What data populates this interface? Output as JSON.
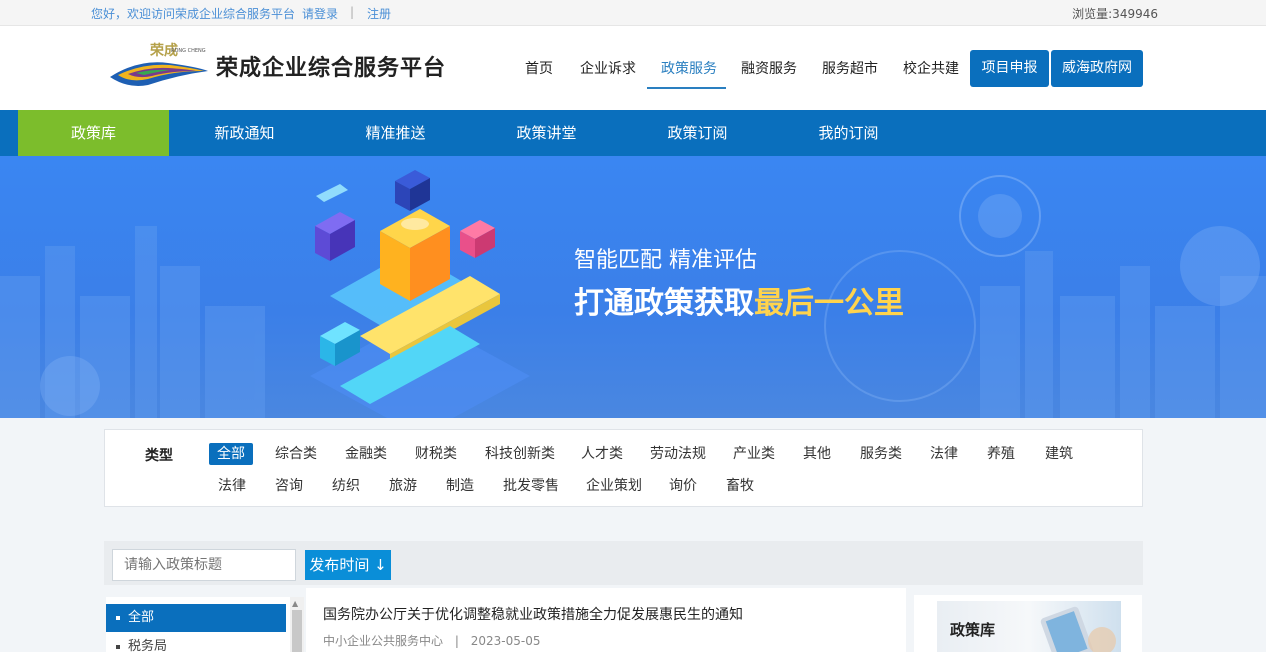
{
  "topbar": {
    "greeting": "您好，欢迎访问荣成企业综合服务平台",
    "login": "请登录",
    "separator": "|",
    "register": "注册",
    "views": "浏览量:349946"
  },
  "header": {
    "logo_text": "RONG CHENG",
    "site_title": "荣成企业综合服务平台",
    "nav": [
      {
        "label": "首页"
      },
      {
        "label": "企业诉求"
      },
      {
        "label": "政策服务"
      },
      {
        "label": "融资服务"
      },
      {
        "label": "服务超市"
      },
      {
        "label": "校企共建"
      }
    ],
    "active_nav": "政策服务",
    "buttons": [
      {
        "label": "项目申报"
      },
      {
        "label": "威海政府网"
      }
    ]
  },
  "subnav": {
    "items": [
      {
        "label": "政策库"
      },
      {
        "label": "新政通知"
      },
      {
        "label": "精准推送"
      },
      {
        "label": "政策讲堂"
      },
      {
        "label": "政策订阅"
      },
      {
        "label": "我的订阅"
      }
    ],
    "active": "政策库"
  },
  "banner": {
    "slogan_line1": "智能匹配 精准评估",
    "slogan_line2_a": "打通政策获取",
    "slogan_line2_b": "最后一公里"
  },
  "filter": {
    "label": "类型",
    "row1": [
      "全部",
      "综合类",
      "金融类",
      "财税类",
      "科技创新类",
      "人才类",
      "劳动法规",
      "产业类",
      "其他",
      "服务类",
      "法律",
      "养殖",
      "建筑"
    ],
    "row2": [
      "法律",
      "咨询",
      "纺织",
      "旅游",
      "制造",
      "批发零售",
      "企业策划",
      "询价",
      "畜牧"
    ],
    "active": "全部"
  },
  "search": {
    "placeholder": "请输入政策标题",
    "sort_label": "发布时间 ↓"
  },
  "categories": {
    "items": [
      {
        "label": "全部"
      },
      {
        "label": "税务局"
      }
    ],
    "active": "全部"
  },
  "policies": [
    {
      "title": "国务院办公厅关于优化调整稳就业政策措施全力促发展惠民生的通知",
      "source": "中小企业公共服务中心",
      "sep": "|",
      "date": "2023-05-05"
    }
  ],
  "right_card": {
    "label": "政策库"
  },
  "colors": {
    "primary": "#0a6fbd",
    "active_green": "#7cbd2c",
    "banner_blue": "#3a86f2",
    "highlight_yellow": "#ffd34d"
  }
}
